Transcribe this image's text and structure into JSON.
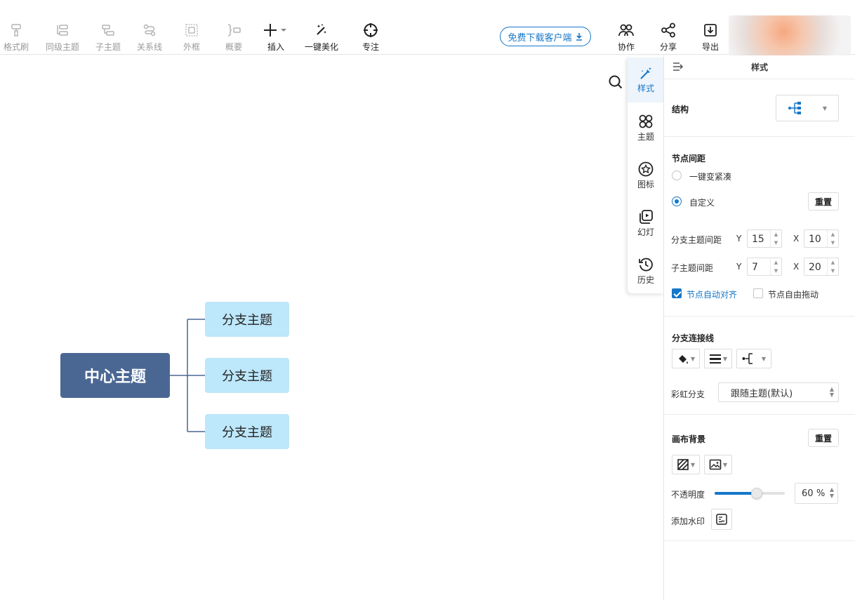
{
  "toolbar": {
    "format_brush": "格式刷",
    "sibling_topic": "同级主题",
    "subtopic": "子主题",
    "relation_line": "关系线",
    "frame": "外框",
    "summary": "概要",
    "insert": "插入",
    "beautify": "一键美化",
    "focus": "专注",
    "download_client": "免费下载客户端",
    "collaborate": "协作",
    "share": "分享",
    "export": "导出"
  },
  "mindmap": {
    "central_topic": "中心主题",
    "branches": [
      "分支主题",
      "分支主题",
      "分支主题"
    ]
  },
  "vtabs": {
    "style": "样式",
    "theme": "主题",
    "icon": "图标",
    "slides": "幻灯",
    "history": "历史"
  },
  "panel": {
    "title": "样式",
    "structure_label": "结构",
    "node_spacing": {
      "title": "节点间距",
      "compact": "一键变紧凑",
      "custom": "自定义",
      "reset": "重置",
      "branch_spacing_label": "分支主题间距",
      "sub_spacing_label": "子主题间距",
      "y_label": "Y",
      "x_label": "X",
      "branch_y": "15",
      "branch_x": "10",
      "sub_y": "7",
      "sub_x": "20",
      "auto_align": "节点自动对齐",
      "free_drag": "节点自由拖动"
    },
    "branch_line": {
      "title": "分支连接线",
      "rainbow_label": "彩虹分支",
      "rainbow_value": "跟随主题(默认)"
    },
    "canvas_bg": {
      "title": "画布背景",
      "reset": "重置",
      "opacity_label": "不透明度",
      "opacity_value": "60",
      "opacity_unit": "%",
      "opacity_fraction": 0.6,
      "watermark_label": "添加水印"
    }
  },
  "colors": {
    "accent": "#1677c9",
    "central_topic_bg": "#4a6794",
    "branch_bg": "#bde7fa"
  }
}
